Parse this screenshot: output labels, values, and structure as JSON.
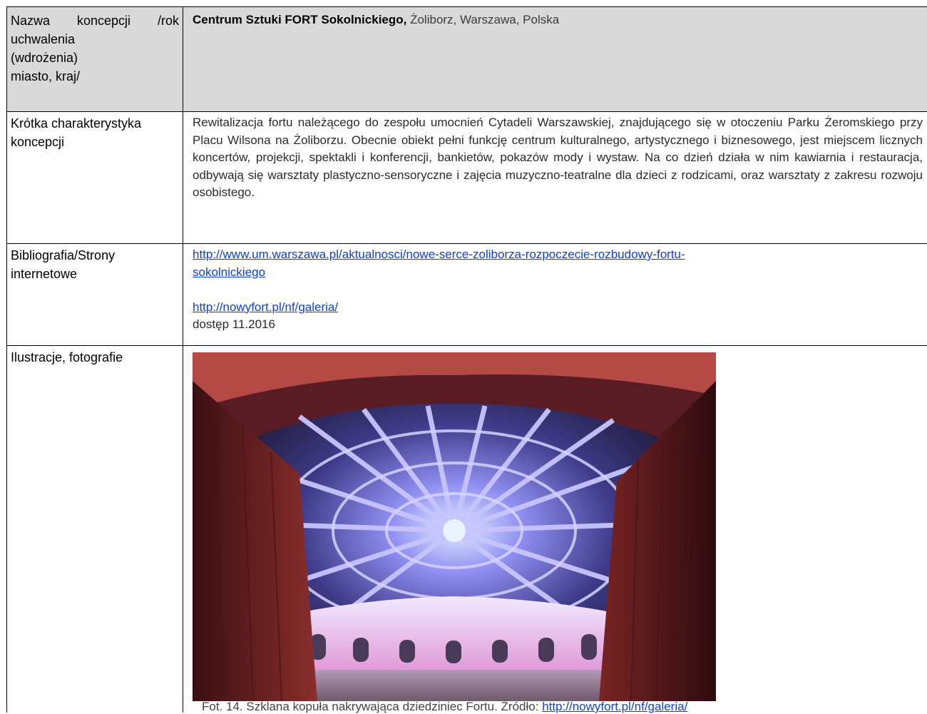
{
  "rows": {
    "name": {
      "label": "Nazwa koncepcji /rok uchwalenia (wdrożenia) miasto, kraj/",
      "label_lines": [
        "Nazwa koncepcji /rok",
        "uchwalenia",
        "(wdrożenia)",
        "miasto, kraj/"
      ],
      "value_bold": "Centrum Sztuki FORT Sokolnickiego,",
      "value_rest": " Żoliborz, Warszawa, Polska"
    },
    "description": {
      "label_lines": [
        "Krótka charakterystyka",
        "koncepcji"
      ],
      "text": "Rewitalizacja fortu należącego do zespołu umocnień Cytadeli Warszawskiej, znajdującego się w otoczeniu Parku Żeromskiego przy Placu Wilsona na Żoliborzu. Obecnie obiekt pełni funkcję centrum kulturalnego, artystycznego i biznesowego, jest miejscem licznych koncertów, projekcji, spektakli i konferencji, bankietów, pokazów mody i wystaw. Na co dzień działa w nim kawiarnia i restauracja, odbywają się warsztaty plastyczno-sensoryczne i zajęcia muzyczno-teatralne dla dzieci z rodzicami, oraz warsztaty z zakresu rozwoju osobistego."
    },
    "bibliography": {
      "label_lines": [
        "Bibliografia/Strony",
        "internetowe"
      ],
      "link1_line1": "http://www.um.warszawa.pl/aktualnosci/nowe-serce-zoliborza-rozpoczecie-rozbudowy-fortu-",
      "link1_line2": "sokolnickiego",
      "link2": "http://nowyfort.pl/nf/galeria/",
      "access_date": "dostęp 11.2016"
    },
    "illustrations": {
      "label": "Ilustracje, fotografie",
      "caption_text": "Fot. 14. Szklana kopuła nakrywająca dziedziniec Fortu. Źródło: ",
      "caption_link": "http://nowyfort.pl/nf/galeria/"
    }
  },
  "colors": {
    "header_bg": "#d9d9d9",
    "link": "#0b3fe0",
    "dome_purple": "#7a55e0",
    "door_red": "#7a1f22"
  }
}
